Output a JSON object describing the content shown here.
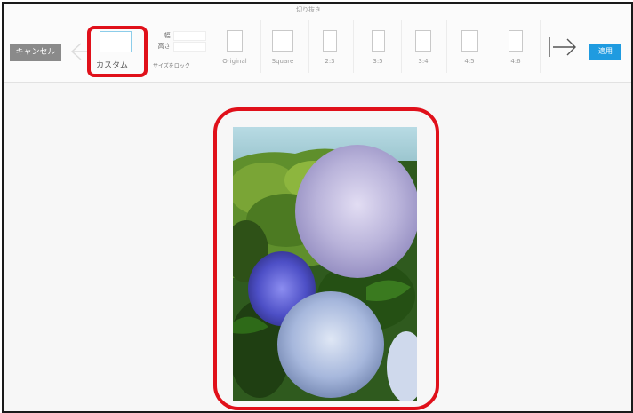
{
  "toolbar": {
    "title": "切り抜き",
    "cancel_label": "キャンセル",
    "apply_label": "適用",
    "custom": {
      "label": "カスタム",
      "width_label": "幅",
      "height_label": "高さ",
      "lock_label": "サイズをロック"
    },
    "ratios": [
      {
        "label": "Original"
      },
      {
        "label": "Square"
      },
      {
        "label": "2:3"
      },
      {
        "label": "3:5"
      },
      {
        "label": "3:4"
      },
      {
        "label": "4:5"
      },
      {
        "label": "4:6"
      }
    ]
  },
  "icons": {
    "prev": "arrow-left-icon",
    "next": "arrow-right-icon"
  },
  "colors": {
    "apply": "#1f9be0",
    "cancel": "#8a8a8a",
    "highlight": "#e0101a",
    "custom_border": "#8ccdea"
  },
  "canvas": {
    "image": "hydrangea-photo"
  }
}
